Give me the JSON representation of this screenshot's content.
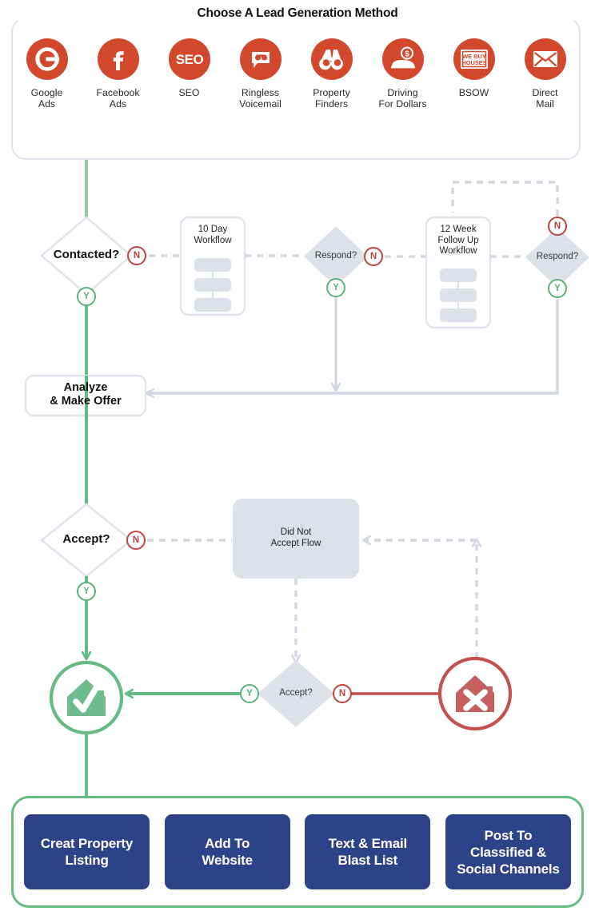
{
  "source_panel": {
    "title": "Choose A Lead Generation Method",
    "items": [
      {
        "icon": "google-g-icon",
        "label": "Google\nAds"
      },
      {
        "icon": "facebook-f-icon",
        "label": "Facebook\nAds"
      },
      {
        "icon": "seo-text-icon",
        "label": "SEO"
      },
      {
        "icon": "voicemail-bubble-icon",
        "label": "Ringless\nVoicemail"
      },
      {
        "icon": "binoculars-icon",
        "label": "Property\nFinders"
      },
      {
        "icon": "car-dollar-icon",
        "label": "Driving\nFor Dollars"
      },
      {
        "icon": "we-buy-houses-sign-icon",
        "label": "BSOW"
      },
      {
        "icon": "envelope-icon",
        "label": "Direct\nMail"
      }
    ]
  },
  "flow": {
    "contacted_decision": "Contacted?",
    "workflow_10day": "10 Day\nWorkflow",
    "respond_decision_1": "Respond?",
    "workflow_12week": "12 Week\nFollow Up\nWorkflow",
    "respond_decision_2": "Respond?",
    "analyze": "Analyze\n& Make Offer",
    "accept_decision_top": "Accept?",
    "did_not_accept_flow": "Did Not\nAccept Flow",
    "accept_decision_bottom": "Accept?",
    "success_node": "house-check-icon",
    "fail_node": "house-x-icon",
    "badges": {
      "yes": "Y",
      "no": "N"
    }
  },
  "output_panel": {
    "boxes": [
      "Creat Property Listing",
      "Add To Website",
      "Text & Email Blast List",
      "Post To Classified & Social Channels"
    ]
  },
  "colors": {
    "icon_red": "#d2482c",
    "green": "#66bb84",
    "green_dark": "#5bb07c",
    "red": "#c0433f",
    "grey_line": "#d2d8e2",
    "grey_fill": "#dde1e8",
    "blue_box": "#2e4387"
  }
}
